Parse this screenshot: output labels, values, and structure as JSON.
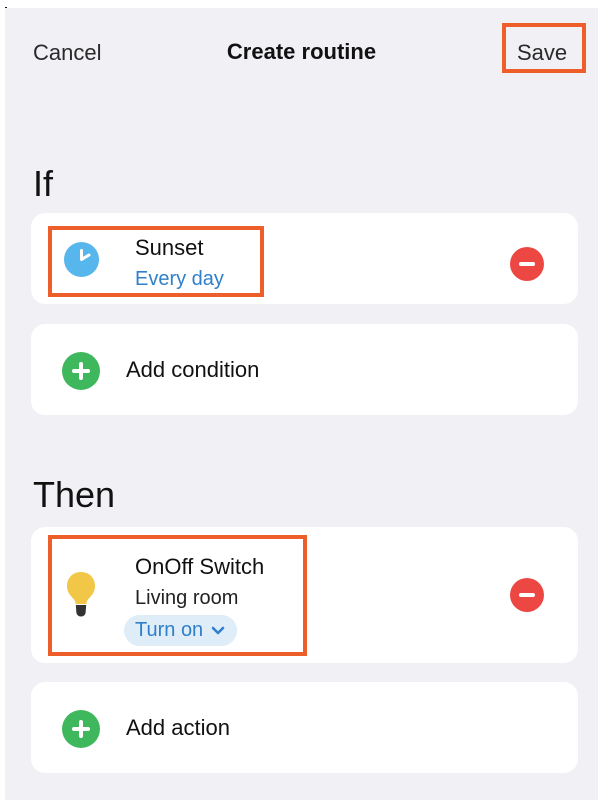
{
  "header": {
    "cancel_label": "Cancel",
    "title": "Create routine",
    "save_label": "Save"
  },
  "if_section": {
    "heading": "If",
    "condition": {
      "title": "Sunset",
      "subtitle": "Every day",
      "icon": "clock-icon"
    },
    "add_label": "Add condition"
  },
  "then_section": {
    "heading": "Then",
    "action": {
      "title": "OnOff Switch",
      "room": "Living room",
      "state": "Turn on",
      "icon": "lightbulb-icon"
    },
    "add_label": "Add action"
  },
  "colors": {
    "background": "#f0f0f5",
    "card": "#ffffff",
    "accent_blue": "#2f7fc9",
    "remove_red": "#ed4743",
    "add_green": "#3fb85d",
    "clock_blue": "#57b6ec",
    "bulb_yellow": "#f2c646",
    "highlight_orange": "#ed5e2a"
  }
}
